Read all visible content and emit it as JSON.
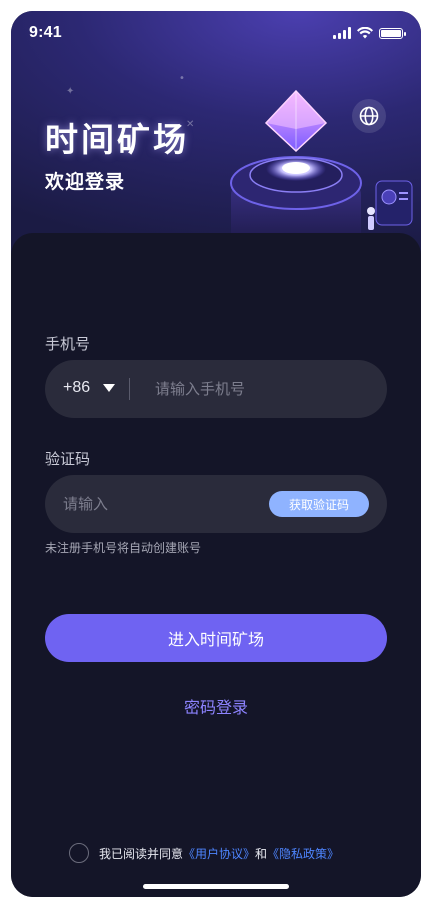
{
  "status_bar": {
    "time": "9:41"
  },
  "hero": {
    "title": "时间矿场",
    "subtitle": "欢迎登录"
  },
  "form": {
    "phone_label": "手机号",
    "country_code": "+86",
    "phone_placeholder": "请输入手机号",
    "code_label": "验证码",
    "code_placeholder": "请输入",
    "get_code_label": "获取验证码",
    "hint": "未注册手机号将自动创建账号",
    "submit_label": "进入时间矿场",
    "password_login_label": "密码登录"
  },
  "agreement": {
    "prefix": "我已阅读并同意",
    "user_agreement": "《用户协议》",
    "and": "和",
    "privacy_policy": "《隐私政策》",
    "checked": false
  },
  "icons": {
    "language": "globe-icon",
    "dropdown": "caret-down-icon"
  },
  "colors": {
    "accent": "#6f63f2",
    "link": "#4e85ff",
    "get_code_button": "#8fb3ff",
    "background": "#141528"
  }
}
